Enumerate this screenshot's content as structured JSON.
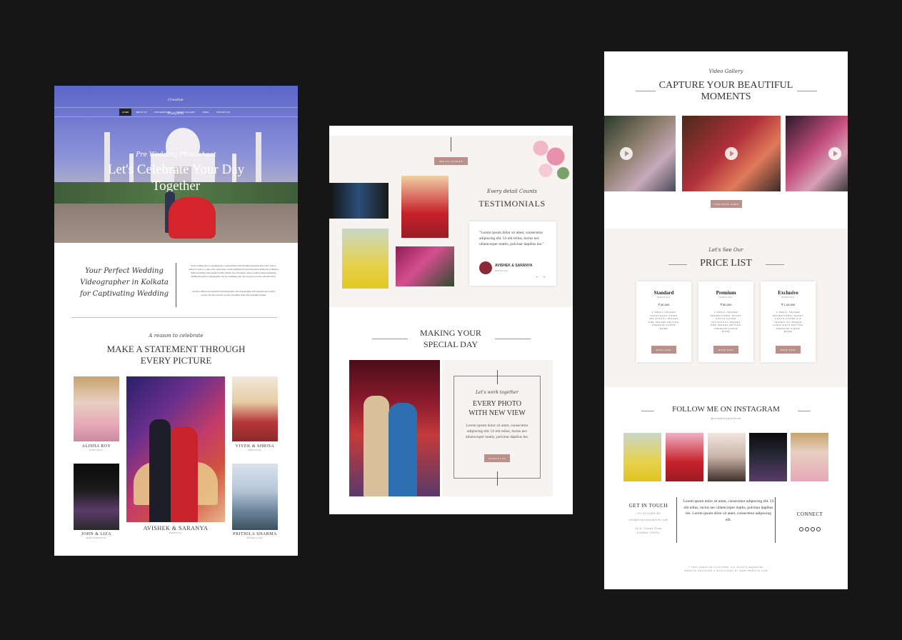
{
  "p1": {
    "logo_text": "Creative Platform",
    "nav": [
      "HOME",
      "ABOUT US",
      "OUR SERVICES",
      "PHOTO GALLERY",
      "VIDEO",
      "CONTACT US"
    ],
    "hero_script": "Pre Wedding Photoshoot",
    "hero_title": "Let's Celebrate Your Day Together",
    "intro_script": "Your Perfect Wedding Videographer in Kolkata for Captivating Wedding",
    "intro_p1": "Your wedding day is a momentous occasion filled with cherished moments that you'll want to relive for years to come. One of the most crucial elements in preserving these memories is hiring a skilled wedding videographer. In the vibrant city of Kolkata, where tradition meets modernity, finding the perfect videographer can be a daunting task. We can give you best outcome work.",
    "intro_p2": "We have skilled and experienced photographer and videographer with talented and creative people. We also provide you the customize video and customize album.",
    "reason_script": "A reason to celebrate",
    "statement_title": "MAKE A STATEMENT THROUGH EVERY PICTURE",
    "captions": [
      {
        "name": "ALISHA ROY",
        "tag": "BIRTHDAY"
      },
      {
        "name": "AVISHEK & SARANYA",
        "tag": "WEDDING"
      },
      {
        "name": "VIVEK & SHRISA",
        "tag": "WEDDING"
      },
      {
        "name": "JOHN & LIZA",
        "tag": "PRE-WEDDING"
      },
      {
        "name": "PRITHILA SHARMA",
        "tag": "MODELLING"
      }
    ]
  },
  "p2": {
    "top_button": "SEE ALL STORIES",
    "testimonial_script": "Every detail Counts",
    "testimonial_title": "TESTIMONIALS",
    "quote": "\"Lorem ipsum dolor sit amet, consectetur adipiscing elit. Ut elit tellus, luctus nec ullamcorper mattis, pulvinar dapibus leo.\"",
    "quote_name": "AVISHEK & SARANYA",
    "quote_tag": "WEDDING",
    "arrows": "← →",
    "special_title": "MAKING YOUR SPECIAL DAY",
    "work_script": "Let's work together",
    "work_title": "EVERY PHOTO WITH NEW VIEW",
    "work_text": "Lorem ipsum dolor sit amet, consectetur adipiscing elit. Ut elit tellus, luctus nec ullamcorper mattis, pulvinar dapibus leo.",
    "work_button": "CONTACT US"
  },
  "p3": {
    "video_script": "Video Gallery",
    "video_title": "CAPTURE YOUR BEAUTIFUL MOMENTS",
    "video_button": "VIEW MORE VIDEO",
    "price_script": "Let's See Our",
    "price_title": "PRICE LIST",
    "plans": [
      {
        "name": "Standard",
        "tag": "WEDDING",
        "price": "₹ 60,000",
        "features": "A SMALL TEASER\nHIGHLIGHTS VIDEO\n300 DIGITAL IMAGES\nPRE-IMAGES EDITING\nPREMIUM ALBUM\nMORE",
        "button": "BOOK NOW"
      },
      {
        "name": "Premium",
        "tag": "WEDDING",
        "price": "₹ 80,000",
        "features": "A SMALL TEASER\nPROMOTIONAL SHOOT\nPHOTO COVER\n200 DIGITAL IMAGES\nPRE-IMAGES EDITING\nPREMIUM ALBUM\nMORE",
        "button": "BOOK NOW"
      },
      {
        "name": "Exclusive",
        "tag": "WEDDING",
        "price": "₹ 1,20,000",
        "features": "A SMALL TEASER\nPROMOTIONAL SHOOT\nPHOTO COVER & 8\nIMAGES TO IMAGES\nHIGHLIGHTS EDITING\nPREMIUM ALBUM\nMORE",
        "button": "BOOK NOW"
      }
    ],
    "insta_title": "FOLLOW ME ON INSTAGRAM",
    "insta_handle": "@creativeplatform",
    "touch_title": "GET IN TOUCH",
    "touch_lines": [
      "+91 9123456789",
      "info@creativeplatform.com",
      "12/A, Chowk Road",
      "Kolkata 700001"
    ],
    "footer_text": "Lorem ipsum dolor sit amet, consectetur adipiscing elit. Ut elit tellus, luctus nec ullamcorper mattis, pulvinar dapibus leo. Lorem ipsum dolor sit amet, consectetur adipiscing elit.",
    "connect_title": "CONNECT",
    "copyright1": "© 2023 CREATIVE PLATFORM. ALL RIGHTS RESERVED",
    "copyright2": "WEBSITE DESIGNED & MAINTAINED BY WWW.WEBSITE.COM"
  },
  "colors": {
    "accent": "#b8918a",
    "bg": "#161616",
    "cream": "#f7f3f0"
  }
}
